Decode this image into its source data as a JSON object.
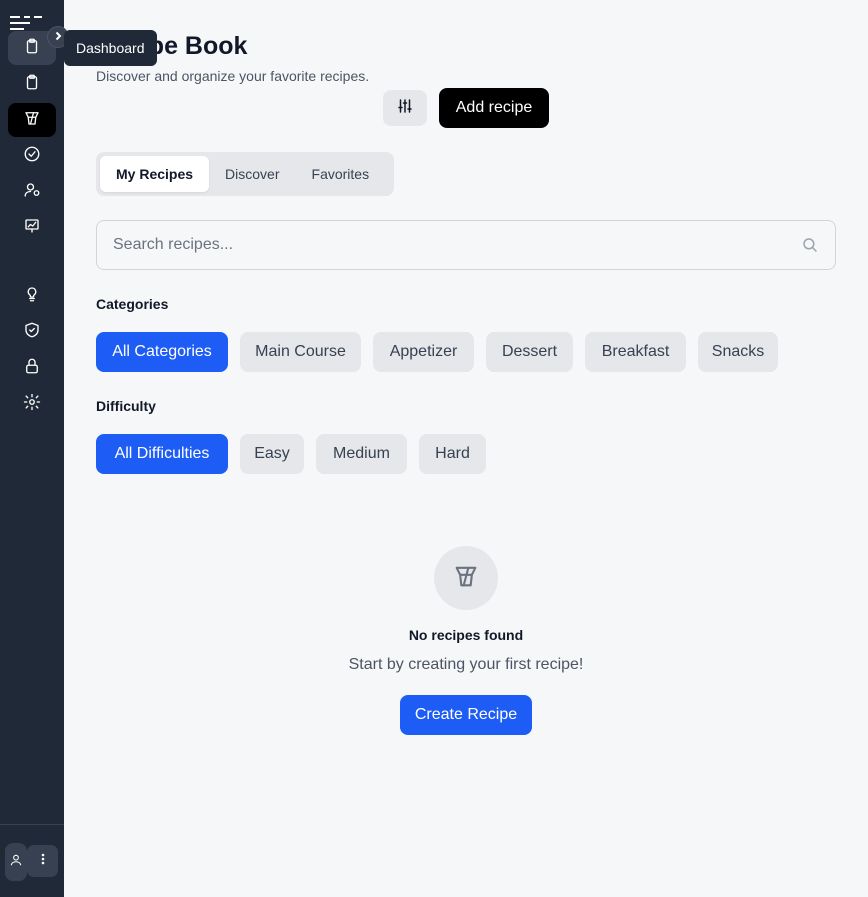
{
  "sidebar": {
    "tooltip": "Dashboard",
    "items": [
      {
        "icon": "clipboard-icon"
      },
      {
        "icon": "clipboard-icon"
      },
      {
        "icon": "recipe-book-icon"
      },
      {
        "icon": "check-circle-icon"
      },
      {
        "icon": "user-cog-icon"
      },
      {
        "icon": "presentation-chart-icon"
      },
      {
        "icon": "lightbulb-icon"
      },
      {
        "icon": "shield-check-icon"
      },
      {
        "icon": "lock-icon"
      },
      {
        "icon": "gear-icon"
      }
    ]
  },
  "header": {
    "title": "Recipe Book",
    "subtitle": "Discover and organize your favorite recipes.",
    "add_label": "Add recipe"
  },
  "tabs": [
    {
      "label": "My Recipes",
      "active": true
    },
    {
      "label": "Discover",
      "active": false
    },
    {
      "label": "Favorites",
      "active": false
    }
  ],
  "search": {
    "placeholder": "Search recipes..."
  },
  "categories": {
    "label": "Categories",
    "items": [
      "All Categories",
      "Main Course",
      "Appetizer",
      "Dessert",
      "Breakfast",
      "Snacks"
    ]
  },
  "difficulty": {
    "label": "Difficulty",
    "items": [
      "All Difficulties",
      "Easy",
      "Medium",
      "Hard"
    ]
  },
  "empty_state": {
    "title": "No recipes found",
    "subtitle": "Start by creating your first recipe!",
    "button": "Create Recipe"
  },
  "colors": {
    "sidebar": "#1f2937",
    "primary": "#1d5cf5",
    "black": "#000000"
  }
}
